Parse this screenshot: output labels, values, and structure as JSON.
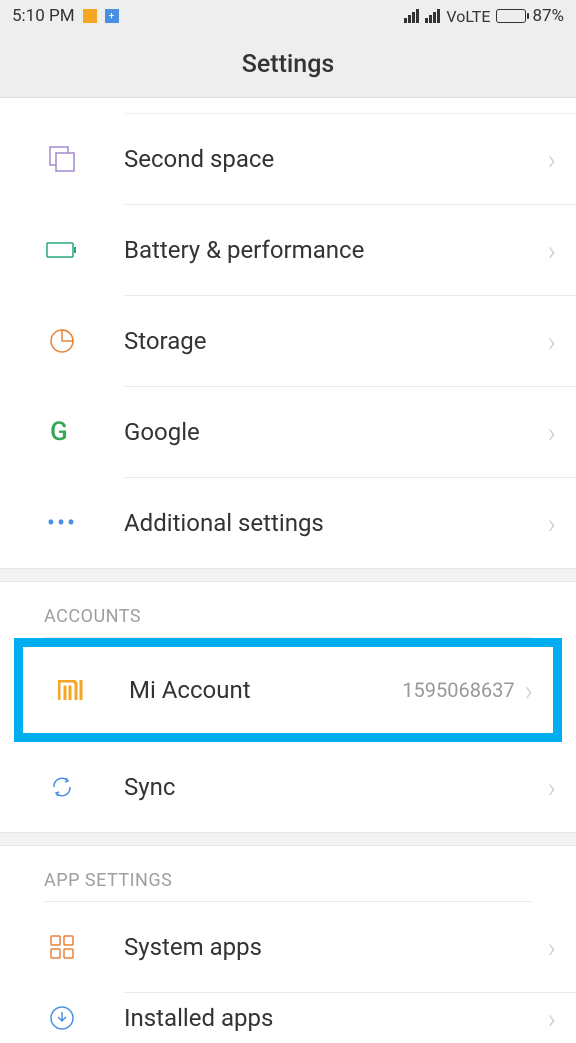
{
  "statusbar": {
    "time": "5:10 PM",
    "volte": "VoLTE",
    "battery_pct": "87%"
  },
  "header": {
    "title": "Settings"
  },
  "items": {
    "second_space": "Second space",
    "battery_perf": "Battery & performance",
    "storage": "Storage",
    "google": "Google",
    "additional": "Additional settings",
    "mi_account": "Mi Account",
    "mi_account_value": "1595068637",
    "sync": "Sync",
    "system_apps": "System apps",
    "installed_apps": "Installed apps"
  },
  "sections": {
    "accounts": "ACCOUNTS",
    "app_settings": "APP SETTINGS"
  }
}
